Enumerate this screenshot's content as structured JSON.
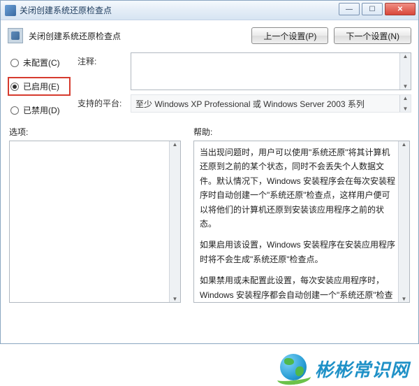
{
  "window": {
    "title": "关闭创建系统还原检查点"
  },
  "header": {
    "text": "关闭创建系统还原检查点"
  },
  "nav": {
    "prev": "上一个设置(P)",
    "next": "下一个设置(N)"
  },
  "radios": {
    "not_configured": "未配置(C)",
    "enabled": "已启用(E)",
    "disabled": "已禁用(D)"
  },
  "fields": {
    "comment_label": "注释:",
    "comment_value": "",
    "platform_label": "支持的平台:",
    "platform_value": "至少 Windows XP Professional 或 Windows Server 2003 系列"
  },
  "panes": {
    "options_label": "选项:",
    "help_label": "帮助:",
    "help_paragraphs": [
      "当出现问题时，用户可以使用\"系统还原\"将其计算机还原到之前的某个状态，同时不会丢失个人数据文件。默认情况下，Windows 安装程序会在每次安装程序时自动创建一个\"系统还原\"检查点，这样用户便可以将他们的计算机还原到安装该应用程序之前的状态。",
      "如果启用该设置，Windows 安装程序在安装应用程序时将不会生成\"系统还原\"检查点。",
      "如果禁用或未配置此设置，每次安装应用程序时，Windows 安装程序都会自动创建一个\"系统还原\"检查点。"
    ]
  },
  "watermark": {
    "text": "彬彬常识网"
  }
}
